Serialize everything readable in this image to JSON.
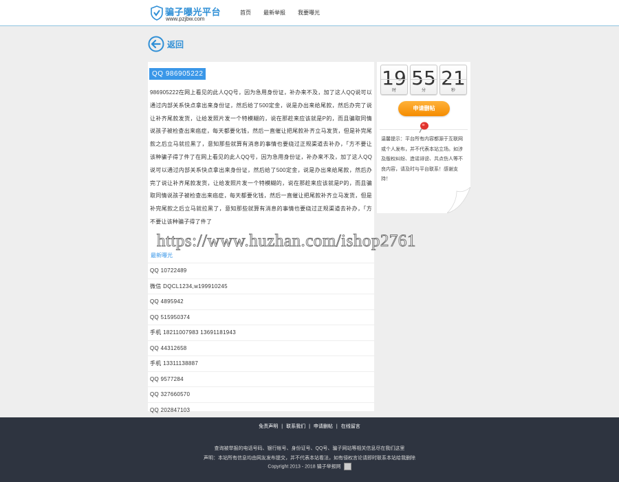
{
  "header": {
    "logo_title": "骗子曝光平台",
    "logo_url": "www.pzjbw.com",
    "nav": [
      "首页",
      "最新举报",
      "我要曝光"
    ]
  },
  "back_label": "返回",
  "main": {
    "qq_title": "QQ 986905222",
    "article": "986905222在网上看见的此人QQ号，因为急用身份证，补办来不及，加了这人QQ说可以通过内部关系快点拿出来身份证，然后给了500定金，说是办出来给尾款，然后办完了说让补齐尾款发货，让给发照片发一个特模糊的，说在那趁来应该就是P的，而且骗取同情说孩子被检查出来癌症，每天都要化钱，然后一直催让把尾款补齐立马发货，但是补完尾款之后立马就拉黑了，意知那些就算有消息的事情也要绕过正规渠道去补办，「方不要让该种骗子得了件了在网上看见的此人QQ号，因为急用身份证，补办来不及，加了这人QQ说可以通过内部关系快点拿出来身份证，然后给了500定金，说是办出来给尾款，然后办完了说让补齐尾款发货，让给发照片发一个特模糊的，说在那趁来应该就是P的，而且骗取同情说孩子被检查出来癌症，每天都要化钱，然后一直催让把尾款补齐立马发货，但是补完尾款之后立马就拉黑了，意知那些就算有消息的事情也要绕过正规渠道去补办，「方不要让该种骗子得了件了",
    "watermark": "https://www.huzhan.com/ishop2761",
    "list_title": "最新曝光",
    "list": [
      "QQ 10722489",
      "微信 DQCL1234,w199910245",
      "QQ 4895942",
      "QQ 515950374",
      "手机 18211007983 13691181943",
      "QQ 44312658",
      "手机 13311138887",
      "QQ 9577284",
      "QQ 327660570",
      "QQ 202847103"
    ]
  },
  "side": {
    "clock": [
      {
        "digits": "19",
        "unit": "时"
      },
      {
        "digits": "55",
        "unit": "分"
      },
      {
        "digits": "21",
        "unit": "秒"
      }
    ],
    "apply_label": "申请删帖",
    "note": "温馨提示：平台所有内容都源于互联网或个人发布，并不代表本站立场。如涉及版权纠纷、造谣诽谤、共点伤人等不良内容，请及时与平台联系！感谢支持！"
  },
  "footer": {
    "links": [
      "免责声明",
      "联系我们",
      "申请删帖",
      "在线留言"
    ],
    "line1": "查询被举报的电话号码、银行帐号、身份证号、QQ号、骗子网站等相关信息尽在我们这里",
    "line2": "声明：本站所有信息均由网友发布提交，并不代表本站看法，如有侵权言论请即时联系本站给我删除",
    "copyright": "Copyright 2013 - 2018 骗子举报网"
  },
  "colors": {
    "brand_blue": "#3a97e8",
    "orange": "#f58c00",
    "footer_bg": "#2e3440",
    "page_bg": "#eeeeee"
  }
}
